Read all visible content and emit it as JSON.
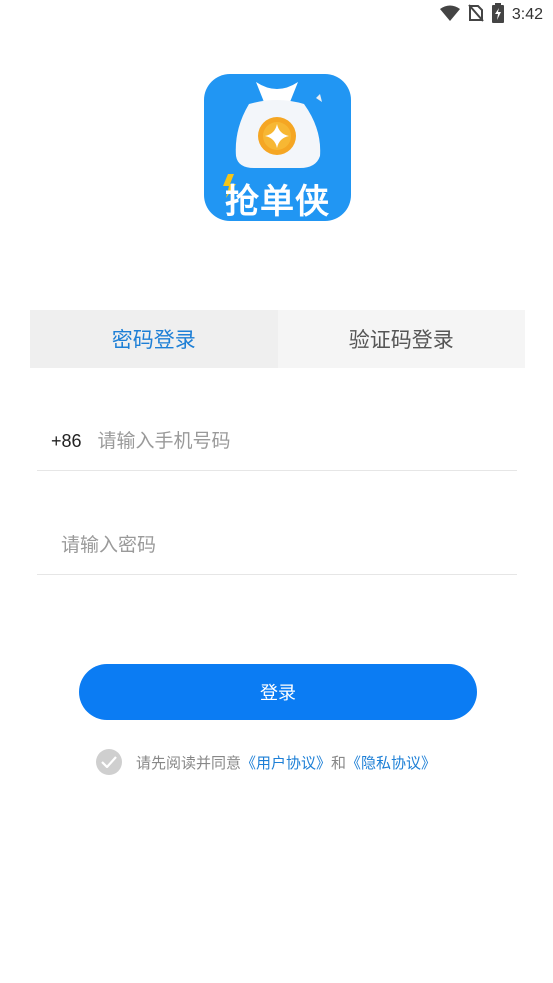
{
  "status_bar": {
    "time": "3:42",
    "icons": [
      "wifi-icon",
      "no-sim-icon",
      "battery-charging-icon"
    ]
  },
  "app": {
    "logo_text": "抢单侠"
  },
  "tabs": [
    {
      "label": "密码登录",
      "active": true
    },
    {
      "label": "验证码登录",
      "active": false
    }
  ],
  "form": {
    "country_code": "+86",
    "phone_placeholder": "请输入手机号码",
    "password_placeholder": "请输入密码",
    "phone_value": "",
    "password_value": ""
  },
  "login_button": {
    "label": "登录"
  },
  "agreement": {
    "prefix": "请先阅读并同意",
    "user_agreement": "《用户协议》",
    "conjunction": "和",
    "privacy_policy": "《隐私协议》"
  },
  "colors": {
    "primary": "#0b7cf3",
    "active_tab_text": "#1d7fd6",
    "logo_bg": "#2196f3",
    "coin": "#f5a623"
  }
}
